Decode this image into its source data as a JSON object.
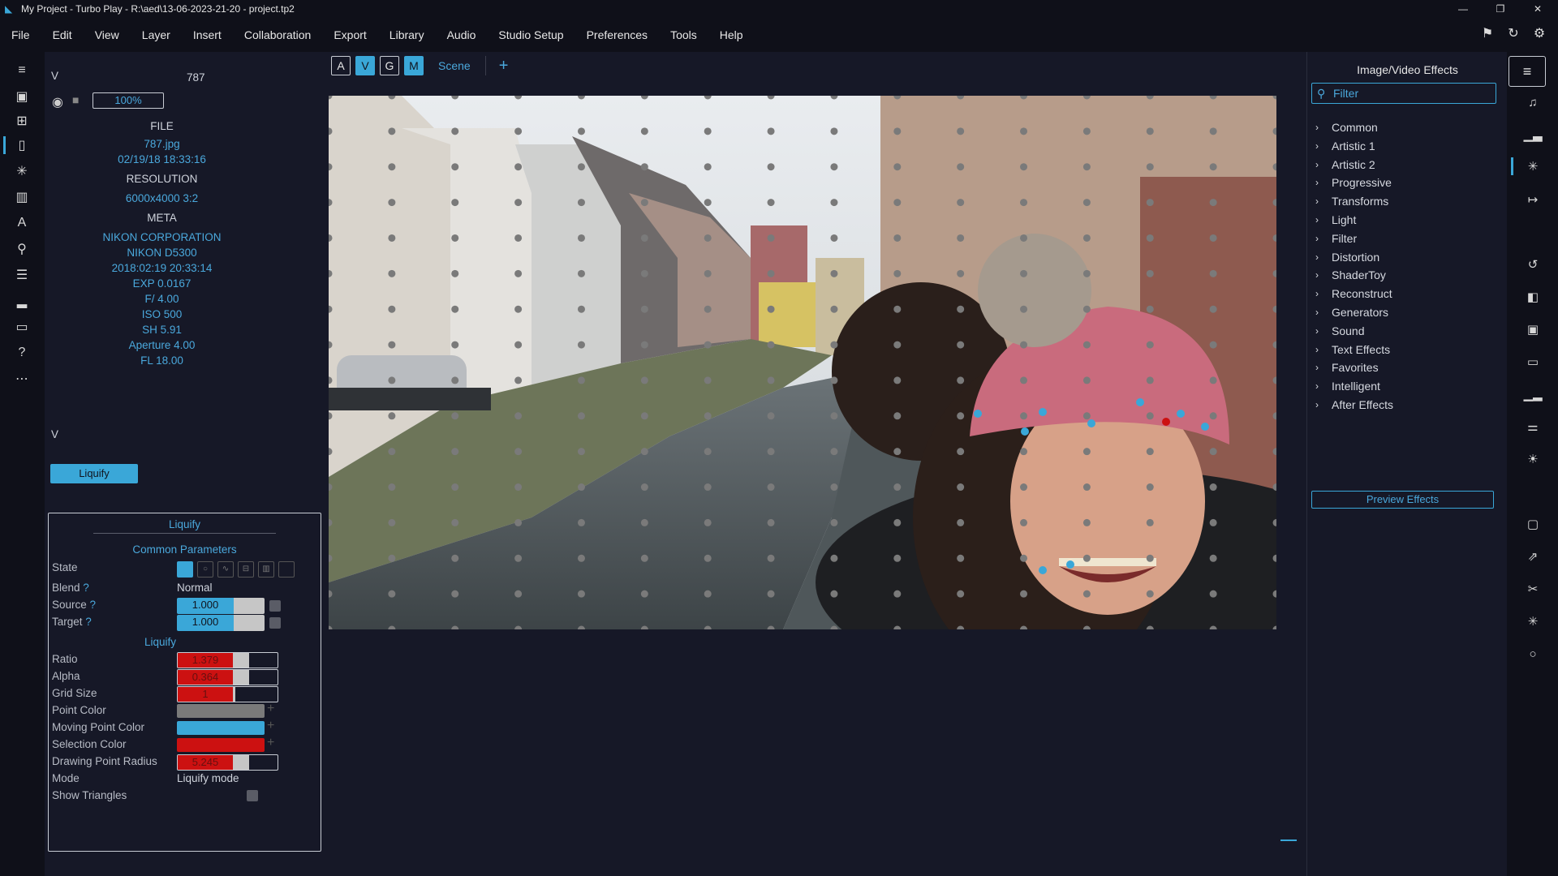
{
  "window": {
    "title": "My Project - Turbo Play - R:\\aed\\13-06-2023-21-20 - project.tp2",
    "minimize": "—",
    "maximize": "❐",
    "close": "✕"
  },
  "menu": [
    "File",
    "Edit",
    "View",
    "Layer",
    "Insert",
    "Collaboration",
    "Export",
    "Library",
    "Audio",
    "Studio Setup",
    "Preferences",
    "Tools",
    "Help"
  ],
  "layer": {
    "v_marker": "V",
    "name": "787",
    "zoom": "100%",
    "v_marker2": "V"
  },
  "file_info": {
    "file_header": "FILE",
    "filename": "787.jpg",
    "date": "02/19/18 18:33:16",
    "res_header": "RESOLUTION",
    "resolution": "6000x4000 3:2",
    "meta_header": "META",
    "meta": [
      "NIKON CORPORATION",
      "NIKON D5300",
      "2018:02:19 20:33:14",
      "EXP 0.0167",
      "F/ 4.00",
      "ISO 500",
      "SH 5.91",
      "Aperture 4.00",
      "FL 18.00"
    ]
  },
  "effect_button": "Liquify",
  "params": {
    "title": "Liquify",
    "common_header": "Common Parameters",
    "state_label": "State",
    "blend_label": "Blend",
    "blend_value": "Normal",
    "help_mark": "?",
    "source_label": "Source",
    "source_value": "1.000",
    "target_label": "Target",
    "target_value": "1.000",
    "liquify_header": "Liquify",
    "ratio_label": "Ratio",
    "ratio_value": "1.379",
    "ratio_fraction": 0.55,
    "alpha_label": "Alpha",
    "alpha_value": "0.364",
    "alpha_fraction": 0.55,
    "grid_label": "Grid Size",
    "grid_value": "1",
    "grid_fraction": 0.55,
    "point_color_label": "Point Color",
    "point_color": "#7a7a7a",
    "moving_color_label": "Moving Point Color",
    "moving_color": "#3aa7d8",
    "selection_color_label": "Selection Color",
    "selection_color": "#cc1111",
    "radius_label": "Drawing Point Radius",
    "radius_value": "5.245",
    "radius_fraction": 0.55,
    "mode_label": "Mode",
    "mode_value": "Liquify mode",
    "triangles_label": "Show Triangles"
  },
  "canvas": {
    "buttons": [
      {
        "label": "A",
        "on": false
      },
      {
        "label": "V",
        "on": true
      },
      {
        "label": "G",
        "on": false
      },
      {
        "label": "M",
        "on": true
      }
    ],
    "scene_label": "Scene",
    "add_label": "+"
  },
  "effects_panel": {
    "title": "Image/Video Effects",
    "filter_placeholder": "Filter",
    "categories": [
      "Common",
      "Artistic 1",
      "Artistic 2",
      "Progressive",
      "Transforms",
      "Light",
      "Filter",
      "Distortion",
      "ShaderToy",
      "Reconstruct",
      "Generators",
      "Sound",
      "Text Effects",
      "Favorites",
      "Intelligent",
      "After Effects"
    ],
    "preview_button": "Preview Effects"
  },
  "colors": {
    "accent": "#3aa7d8",
    "red": "#cc1111"
  }
}
